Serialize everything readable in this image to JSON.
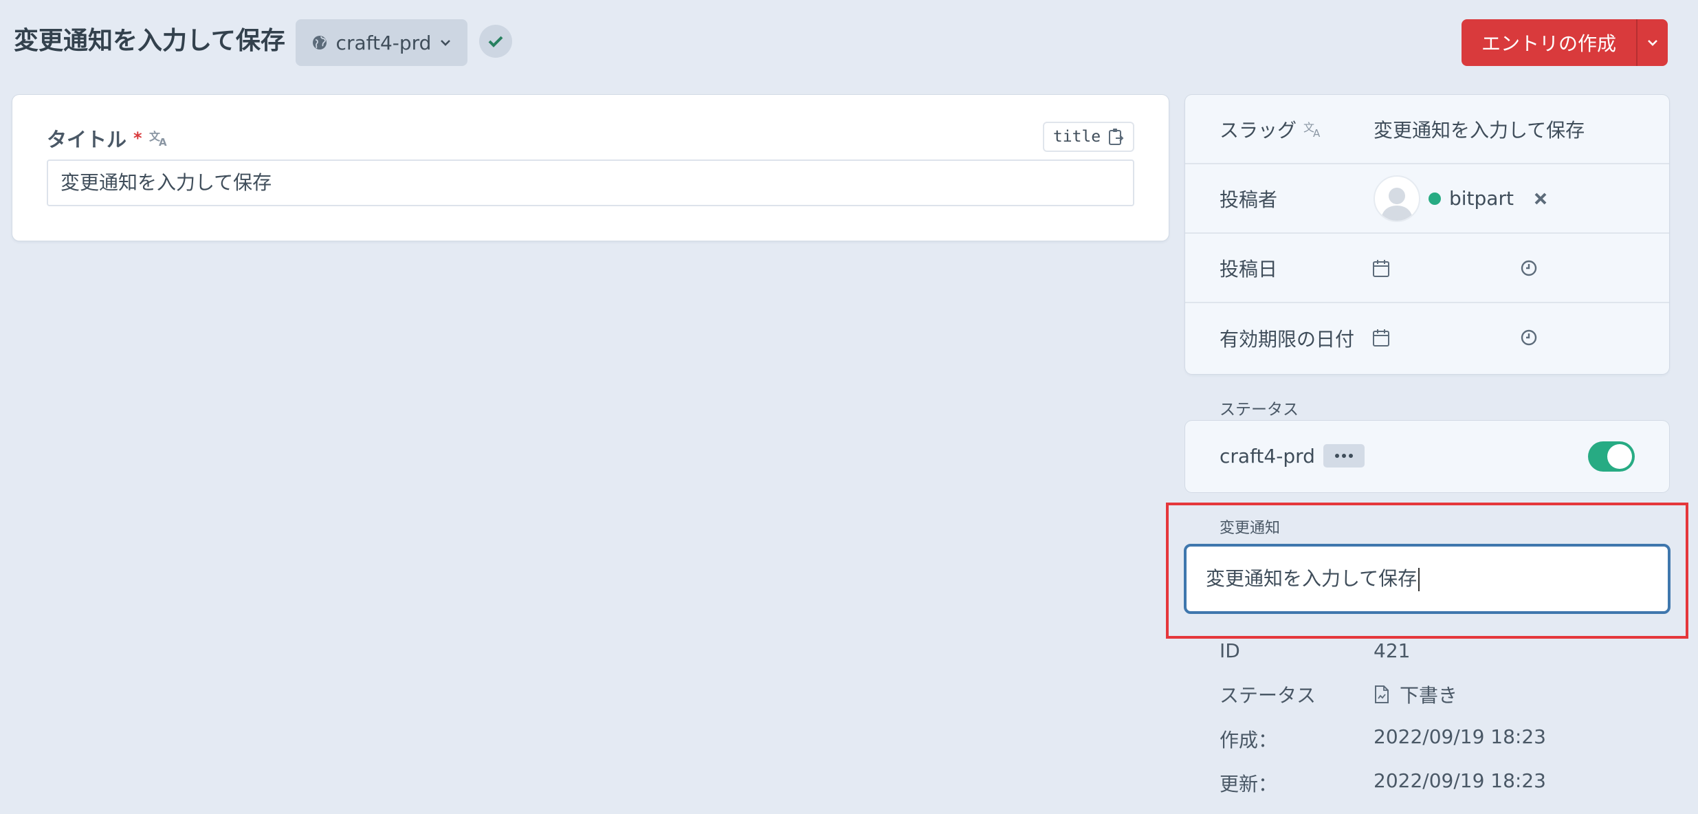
{
  "header": {
    "title": "変更通知を入力して保存",
    "site_selector": "craft4-prd",
    "create_button": "エントリの作成"
  },
  "title_field": {
    "label": "タイトル",
    "required_mark": "*",
    "handle": "title",
    "value": "変更通知を入力して保存"
  },
  "meta": {
    "slug_label": "スラッグ",
    "slug_value": "変更通知を入力して保存",
    "author_label": "投稿者",
    "author_name": "bitpart",
    "post_date_label": "投稿日",
    "expiry_date_label": "有効期限の日付"
  },
  "status_section": {
    "heading": "ステータス",
    "site_name": "craft4-prd",
    "enabled": true
  },
  "change_notice": {
    "heading": "変更通知",
    "value": "変更通知を入力して保存"
  },
  "info": {
    "id_label": "ID",
    "id_value": "421",
    "status_label": "ステータス",
    "status_value": "下書き",
    "created_label": "作成：",
    "created_value": "2022/09/19 18:23",
    "updated_label": "更新：",
    "updated_value": "2022/09/19 18:23"
  },
  "colors": {
    "background": "#e4eaf3",
    "primary_button": "#d93a3c",
    "enabled_green": "#27ab83",
    "focus_blue": "#3f77ad",
    "highlight_red": "#e5373b"
  },
  "icons": [
    "globe-icon",
    "chevron-down-icon",
    "check-icon",
    "translate-icon",
    "clipboard-icon",
    "remove-icon",
    "calendar-icon",
    "clock-icon",
    "ellipsis-icon",
    "draft-icon"
  ]
}
